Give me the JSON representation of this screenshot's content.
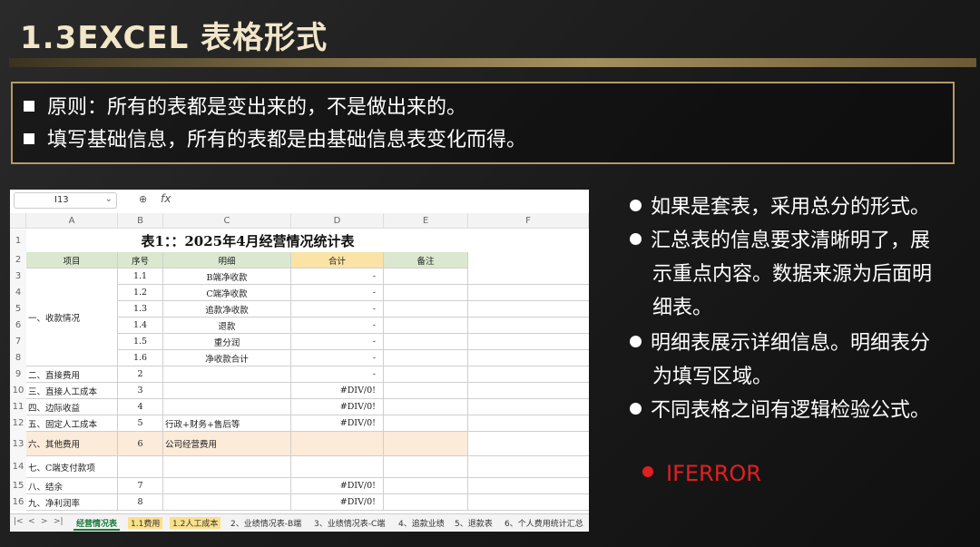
{
  "title": "1.3EXCEL 表格形式",
  "principles": [
    "原则：所有的表都是变出来的，不是做出来的。",
    "填写基础信息，所有的表都是由基础信息表变化而得。"
  ],
  "spreadsheet": {
    "cell_ref": "I13",
    "fx_label": "fx",
    "columns": [
      "A",
      "B",
      "C",
      "D",
      "E",
      "F"
    ],
    "title": "表1：：2025年4月经营情况统计表",
    "headers": [
      "项目",
      "序号",
      "明细",
      "合计",
      "备注"
    ],
    "row_numbers": [
      "1",
      "2",
      "3",
      "4",
      "5",
      "6",
      "7",
      "8",
      "9",
      "10",
      "11",
      "12",
      "13",
      "14",
      "15",
      "16"
    ],
    "group_label": "一、收款情况",
    "rows": [
      {
        "b": "1.1",
        "c": "B端净收款",
        "d": "-"
      },
      {
        "b": "1.2",
        "c": "C端净收款",
        "d": "-"
      },
      {
        "b": "1.3",
        "c": "追款净收款",
        "d": "-"
      },
      {
        "b": "1.4",
        "c": "退款",
        "d": "-"
      },
      {
        "b": "1.5",
        "c": "重分润",
        "d": "-"
      },
      {
        "b": "1.6",
        "c": "净收款合计",
        "d": "-"
      },
      {
        "a": "二、直接费用",
        "b": "2",
        "c": "",
        "d": "-"
      },
      {
        "a": "三、直接人工成本",
        "b": "3",
        "c": "",
        "d": "#DIV/0!"
      },
      {
        "a": "四、边际收益",
        "b": "4",
        "c": "",
        "d": "#DIV/0!"
      },
      {
        "a": "五、固定人工成本",
        "b": "5",
        "c": "行政+财务+售后等",
        "d": "#DIV/0!"
      },
      {
        "a": "六、其他费用",
        "b": "6",
        "c": "公司经营费用",
        "d": ""
      },
      {
        "a": "七、C端支付款项",
        "b": "",
        "c": "",
        "d": ""
      },
      {
        "a": "八、结余",
        "b": "7",
        "c": "",
        "d": "#DIV/0!"
      },
      {
        "a": "九、净利润率",
        "b": "8",
        "c": "",
        "d": "#DIV/0!"
      }
    ],
    "tabs": [
      "经营情况表",
      "1.1费用",
      "1.2人工成本",
      "2、业绩情况表-B端",
      "3、业绩情况表-C端",
      "4、追款业绩",
      "5、退款表",
      "6、个人费用统计汇总"
    ],
    "nav": [
      "|<",
      "<",
      ">",
      ">|"
    ]
  },
  "bullets": [
    "如果是套表，采用总分的形式。",
    "汇总表的信息要求清晰明了，展",
    "示重点内容。数据来源为后面明",
    "细表。",
    "明细表展示详细信息。明细表分",
    "为填写区域。",
    "不同表格之间有逻辑检验公式。"
  ],
  "iferror": "IFERROR",
  "colors": {
    "accent_gold": "#b49a64",
    "header_green": "#dbe8cf",
    "header_yellow": "#fbe3a6",
    "iferror_red": "#e02020"
  }
}
